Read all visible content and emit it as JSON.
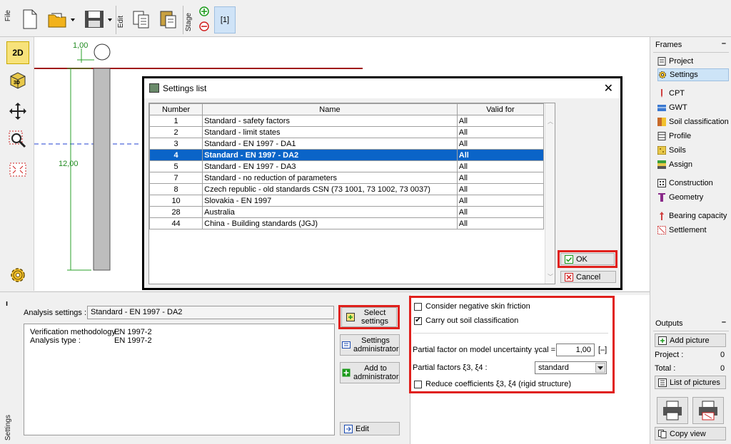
{
  "toolbar": {
    "file_label": "File",
    "edit_label": "Edit",
    "stage_label": "Stage",
    "stage_number": "[1]"
  },
  "canvas": {
    "dim_top": "1,00",
    "dim_left": "12,00"
  },
  "dialog": {
    "title": "Settings list",
    "columns": [
      "Number",
      "Name",
      "Valid for"
    ],
    "rows": [
      {
        "number": "1",
        "name": "Standard - safety factors",
        "valid": "All"
      },
      {
        "number": "2",
        "name": "Standard - limit states",
        "valid": "All"
      },
      {
        "number": "3",
        "name": "Standard - EN 1997 - DA1",
        "valid": "All"
      },
      {
        "number": "4",
        "name": "Standard - EN 1997 - DA2",
        "valid": "All"
      },
      {
        "number": "5",
        "name": "Standard - EN 1997 - DA3",
        "valid": "All"
      },
      {
        "number": "7",
        "name": "Standard - no reduction of parameters",
        "valid": "All"
      },
      {
        "number": "8",
        "name": "Czech republic - old standards CSN (73 1001, 73 1002, 73 0037)",
        "valid": "All"
      },
      {
        "number": "10",
        "name": "Slovakia - EN 1997",
        "valid": "All"
      },
      {
        "number": "28",
        "name": "Australia",
        "valid": "All"
      },
      {
        "number": "44",
        "name": "China - Building standards (JGJ)",
        "valid": "All"
      }
    ],
    "selected_number": "4",
    "ok_label": "OK",
    "cancel_label": "Cancel"
  },
  "frames": {
    "header": "Frames",
    "items": [
      "Project",
      "Settings",
      "CPT",
      "GWT",
      "Soil classification",
      "Profile",
      "Soils",
      "Assign",
      "Construction",
      "Geometry",
      "Bearing capacity",
      "Settlement"
    ],
    "active": "Settings"
  },
  "outputs": {
    "header": "Outputs",
    "add_picture": "Add picture",
    "project_label": "Project :",
    "project_count": "0",
    "total_label": "Total :",
    "total_count": "0",
    "list_pictures": "List of pictures",
    "copy_view": "Copy view"
  },
  "settings": {
    "side_label": "Settings",
    "analysis_label": "Analysis settings :",
    "analysis_value": "Standard - EN 1997 - DA2",
    "verif_label": "Verification methodology :",
    "verif_value": "EN 1997-2",
    "type_label": "Analysis type :",
    "type_value": "EN 1997-2",
    "select_btn": "Select settings",
    "admin_btn": "Settings administrator",
    "add_admin_btn": "Add to administrator",
    "edit_btn": "Edit",
    "neg_skin": "Consider negative skin friction",
    "neg_skin_checked": false,
    "soil_class": "Carry out soil classification",
    "soil_class_checked": true,
    "partial_model_label": "Partial factor on model uncertainty :",
    "gamma_label": "γcal =",
    "gamma_value": "1,00",
    "gamma_unit": "[–]",
    "partial_xi_label": "Partial factors ξ3, ξ4 :",
    "partial_xi_value": "standard",
    "reduce_coef": "Reduce coefficients ξ3, ξ4 (rigid structure)",
    "reduce_checked": false
  },
  "colors": {
    "highlight": "#e0201c",
    "selection": "#0a64c8",
    "active_frame": "#cde4f7"
  }
}
